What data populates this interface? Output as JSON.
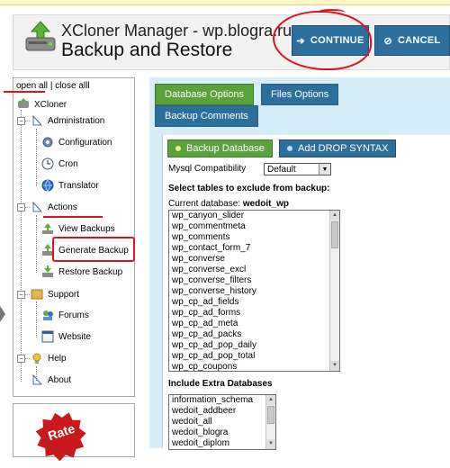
{
  "header": {
    "app_title": "XCloner Manager - wp.blogra.ru",
    "page_title": "Backup and Restore",
    "continue_label": "CONTINUE",
    "cancel_label": "CANCEL"
  },
  "sidebar": {
    "open_all": "open all",
    "separator": "|",
    "close_all": "close alll",
    "root": "XCloner",
    "groups": [
      {
        "label": "Administration",
        "items": [
          "Configuration",
          "Cron",
          "Translator"
        ]
      },
      {
        "label": "Actions",
        "items": [
          "View Backups",
          "Generate Backup",
          "Restore Backup"
        ]
      },
      {
        "label": "Support",
        "items": [
          "Forums",
          "Website"
        ]
      },
      {
        "label": "Help",
        "items": [
          "About"
        ]
      }
    ],
    "rate_text": "Rate"
  },
  "tabs": {
    "database": "Database Options",
    "files": "Files Options",
    "comments": "Backup Comments"
  },
  "content": {
    "backup_database": "Backup Database",
    "add_drop_syntax": "Add DROP SYNTAX",
    "mysql_label": "Mysql Compatibility",
    "mysql_value": "Default",
    "exclude_label": "Select tables to exclude from backup:",
    "current_db_label": "Current database:",
    "current_db_name": "wedoit_wp",
    "tables": [
      "wp_canyon_slider",
      "wp_commentmeta",
      "wp_comments",
      "wp_contact_form_7",
      "wp_converse",
      "wp_converse_excl",
      "wp_converse_filters",
      "wp_converse_history",
      "wp_cp_ad_fields",
      "wp_cp_ad_forms",
      "wp_cp_ad_meta",
      "wp_cp_ad_packs",
      "wp_cp_ad_pop_daily",
      "wp_cp_ad_pop_total",
      "wp_cp_coupons"
    ],
    "extra_label": "Include Extra Databases",
    "extra_databases": [
      "information_schema",
      "wedoit_addbeer",
      "wedoit_all",
      "wedoit_blogra",
      "wedoit_diplom"
    ]
  },
  "colors": {
    "accent_blue": "#2d6f9c",
    "accent_green": "#5aa23c",
    "annotation_red": "#e0121f"
  }
}
